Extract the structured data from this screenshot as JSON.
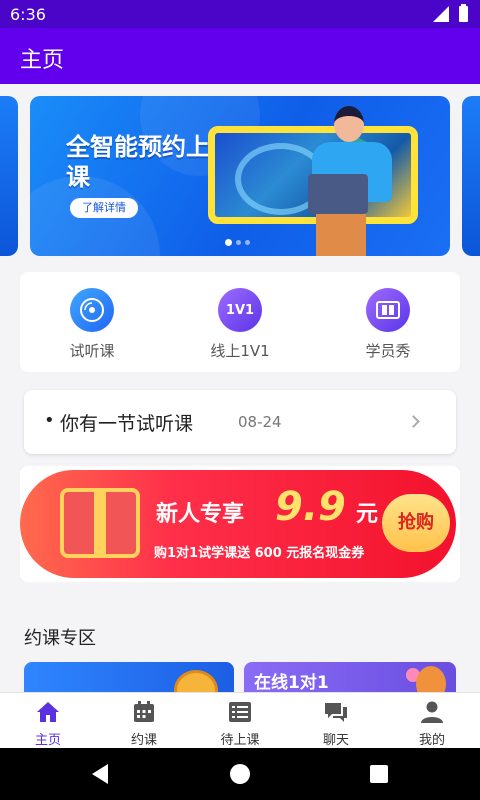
{
  "status_bar": {
    "time": "6:36"
  },
  "app_bar": {
    "title": "主页"
  },
  "banner": {
    "title": "全智能预约上课",
    "button_label": "了解详情",
    "slide_count": 3,
    "active_slide": 1
  },
  "quick_actions": [
    {
      "label": "试听课",
      "icon": "disc-icon",
      "icon_text": ""
    },
    {
      "label": "线上1V1",
      "icon": "book-1v1-icon",
      "icon_text": "1V1"
    },
    {
      "label": "学员秀",
      "icon": "gallery-icon",
      "icon_text": ""
    }
  ],
  "notice": {
    "text": "你有一节试听课",
    "date": "08-24"
  },
  "promo": {
    "title": "新人专享",
    "price": "9.9",
    "unit": "元",
    "subtitle": "购1对1试学课送 600 元报名现金券",
    "button_label": "抢购"
  },
  "section": {
    "title": "约课专区"
  },
  "course_cards": [
    {
      "label": ""
    },
    {
      "label": "在线1对1"
    }
  ],
  "bottom_nav": [
    {
      "label": "主页",
      "icon": "home-icon",
      "active": true
    },
    {
      "label": "约课",
      "icon": "calendar-icon",
      "active": false
    },
    {
      "label": "待上课",
      "icon": "list-icon",
      "active": false
    },
    {
      "label": "聊天",
      "icon": "chat-icon",
      "active": false
    },
    {
      "label": "我的",
      "icon": "person-icon",
      "active": false
    }
  ],
  "colors": {
    "status_bar": "#4b05c9",
    "app_bar": "#6200ee",
    "accent": "#5a32e0",
    "promo_red": "#f3122d"
  }
}
